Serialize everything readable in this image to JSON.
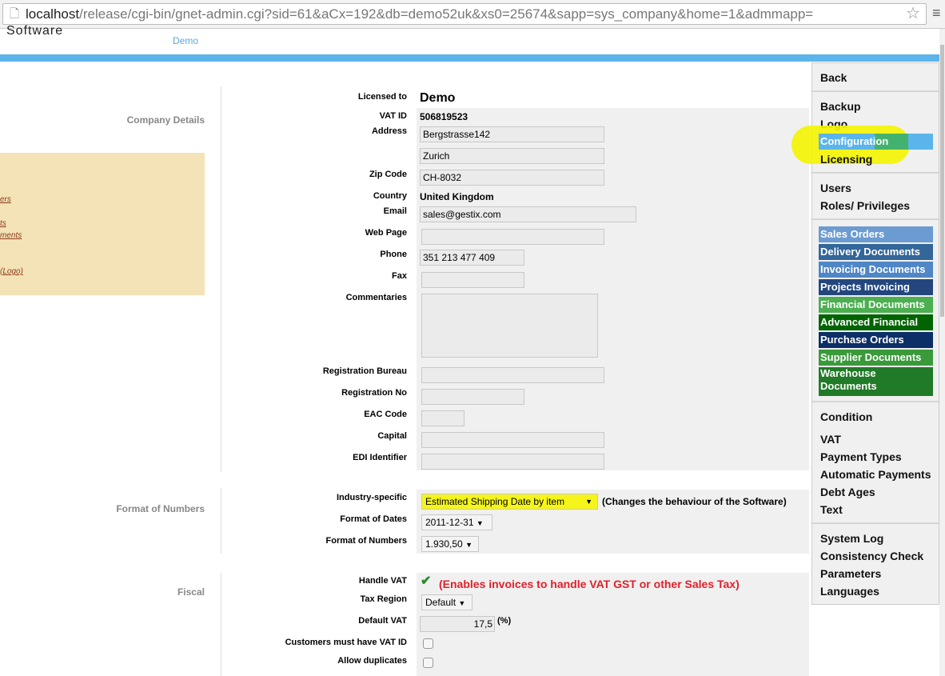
{
  "browser": {
    "url_host": "localhost",
    "url_rest": "/release/cgi-bin/gnet-admin.cgi?sid=61&aCx=192&db=demo52uk&xs0=25674&sapp=sys_company&home=1&admmapp="
  },
  "header": {
    "brand": "Software",
    "user_link": "Demo"
  },
  "left": {
    "company_details": "Company Details",
    "format_numbers": "Format of Numbers",
    "fiscal": "Fiscal",
    "links": [
      "ers",
      "ts",
      "ments",
      "(Logo)"
    ]
  },
  "company": {
    "licensed_to_label": "Licensed to",
    "licensed_to": "Demo",
    "vat_id_label": "VAT ID",
    "vat_id": "506819523",
    "address_label": "Address",
    "address1": "Bergstrasse142",
    "address2": "Zurich",
    "zip_label": "Zip Code",
    "zip": "CH-8032",
    "country_label": "Country",
    "country": "United Kingdom",
    "email_label": "Email",
    "email": "sales@gestix.com",
    "web_label": "Web Page",
    "web": "",
    "phone_label": "Phone",
    "phone": "351 213 477 409",
    "fax_label": "Fax",
    "fax": "",
    "comments_label": "Commentaries",
    "comments": "",
    "reg_bureau_label": "Registration Bureau",
    "reg_no_label": "Registration No",
    "eac_label": "EAC Code",
    "capital_label": "Capital",
    "edi_label": "EDI Identifier"
  },
  "numbers": {
    "industry_label": "Industry-specific",
    "industry": "Estimated Shipping Date by item",
    "industry_note": "(Changes the behaviour of the Software)",
    "dates_label": "Format of Dates",
    "dates": "2011-12-31",
    "numbers_label": "Format of Numbers",
    "numbers": "1.930,50"
  },
  "fiscal": {
    "handle_vat_label": "Handle VAT",
    "handle_vat": true,
    "handle_vat_note": "(Enables invoices to handle VAT GST or other Sales Tax)",
    "tax_region_label": "Tax Region",
    "tax_region": "Default",
    "default_vat_label": "Default VAT",
    "default_vat": "17,5",
    "pct": "(%)",
    "cust_vat_label": "Customers must have VAT ID",
    "cust_vat": false,
    "dup_label": "Allow duplicates",
    "dup": false
  },
  "menu": {
    "back": "Back",
    "group1": [
      "Backup",
      "Logo",
      "Configuration",
      "Licensing"
    ],
    "group2": [
      "Users",
      "Roles/ Privileges"
    ],
    "modules": [
      {
        "label": "Sales Orders",
        "color": "#6b9bd0"
      },
      {
        "label": "Delivery Documents",
        "color": "#336699"
      },
      {
        "label": "Invoicing Documents",
        "color": "#4f86c6"
      },
      {
        "label": "Projects Invoicing",
        "color": "#23467f"
      },
      {
        "label": "Financial Documents",
        "color": "#4caf50"
      },
      {
        "label": "Advanced Financial",
        "color": "#006400"
      },
      {
        "label": "Purchase Orders",
        "color": "#0b2f66"
      },
      {
        "label": "Supplier Documents",
        "color": "#3a9a3a"
      },
      {
        "label": "Warehouse Documents",
        "color": "#207a27"
      }
    ],
    "group3": [
      "Condition",
      "VAT",
      "Payment Types",
      "Automatic Payments",
      "Debt Ages",
      "Text"
    ],
    "group4": [
      "System Log",
      "Consistency Check",
      "Parameters",
      "Languages"
    ]
  },
  "colors": {
    "accent": "#5bb5ea",
    "highlight": "#f0f000",
    "selected": "#5bb5ea"
  }
}
